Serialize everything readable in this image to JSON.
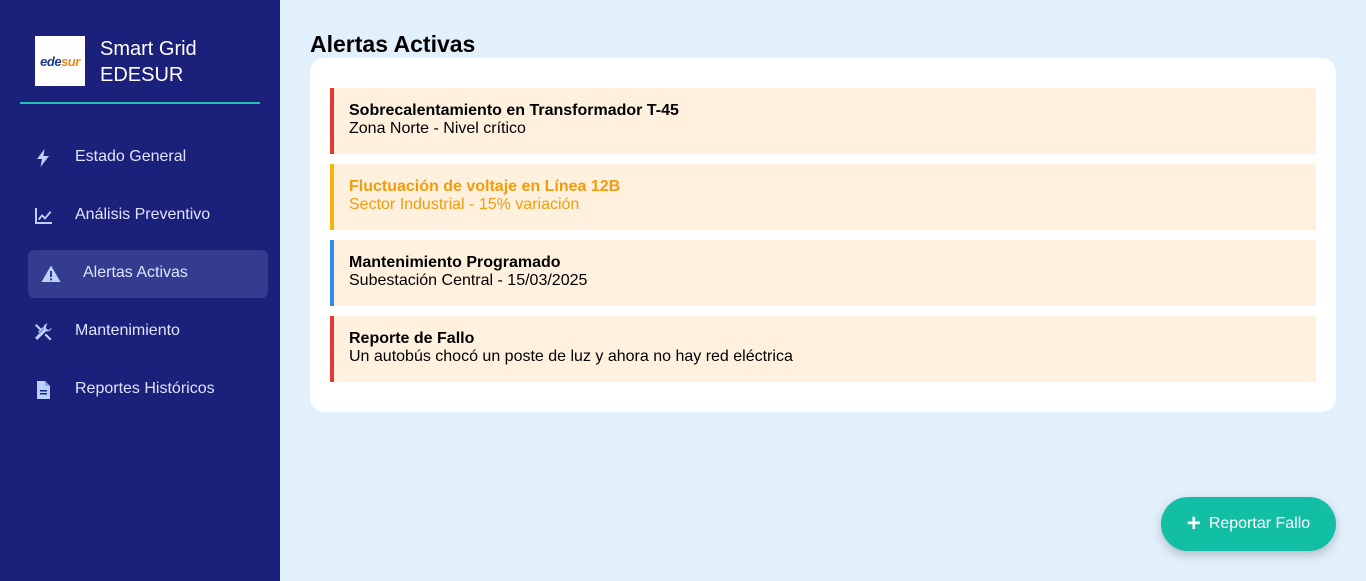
{
  "brand": {
    "logo": {
      "part1": "ede",
      "part2": "sur"
    },
    "title": "Smart Grid\nEDESUR"
  },
  "sidebar": {
    "items": [
      {
        "label": "Estado General",
        "icon": "bolt-icon"
      },
      {
        "label": "Análisis Preventivo",
        "icon": "chart-line-icon"
      },
      {
        "label": "Alertas Activas",
        "icon": "warning-icon",
        "active": true
      },
      {
        "label": "Mantenimiento",
        "icon": "tools-icon"
      },
      {
        "label": "Reportes Históricos",
        "icon": "file-icon"
      }
    ]
  },
  "main": {
    "title": "Alertas Activas",
    "alerts": [
      {
        "title": "Sobrecalentamiento en Transformador T-45",
        "desc": "Zona Norte - Nivel crítico",
        "level": "critical",
        "color": "#e53935"
      },
      {
        "title": "Fluctuación de voltaje en Línea 12B",
        "desc": "Sector Industrial - 15% variación",
        "level": "warning",
        "color": "#f5b50a"
      },
      {
        "title": "Mantenimiento Programado",
        "desc": "Subestación Central - 15/03/2025",
        "level": "info",
        "color": "#2e8ee6"
      },
      {
        "title": "Reporte de Fallo",
        "desc": "Un autobús chocó un poste de luz y ahora no hay red eléctrica",
        "level": "critical",
        "color": "#e53935"
      }
    ]
  },
  "fab": {
    "label": "Reportar Fallo",
    "icon": "plus-icon"
  },
  "colors": {
    "sidebar_bg": "#1b217a",
    "accent": "#12bfa5",
    "page_bg": "#e2f0fb",
    "alert_bg": "#fff1de"
  }
}
